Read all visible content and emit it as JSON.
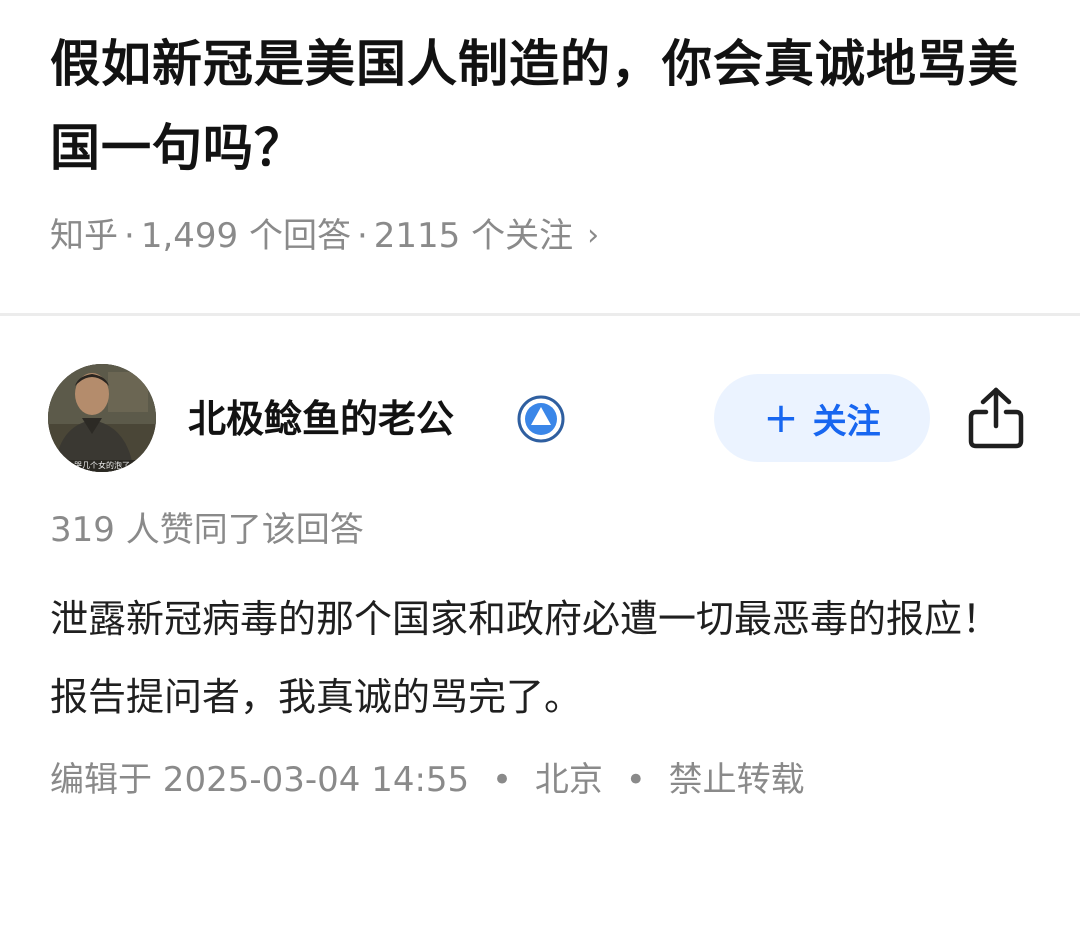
{
  "question": {
    "title": "假如新冠是美国人制造的，你会真诚地骂美国一句吗？",
    "source": "知乎",
    "answer_count": "1,499 个回答",
    "follower_count": "2115 个关注",
    "separator": "·",
    "chevron": "›"
  },
  "author": {
    "name": "北极鲶鱼的老公",
    "avatar_caption": "哭几个女的泡了",
    "badge_icon": "verified-badge-icon"
  },
  "actions": {
    "follow_plus": "+",
    "follow_label": "关注",
    "share_icon": "share-icon"
  },
  "answer": {
    "votes": "319 人赞同了该回答",
    "paragraphs": [
      "泄露新冠病毒的那个国家和政府必遭一切最恶毒的报应！",
      "报告提问者，我真诚的骂完了。"
    ],
    "edited_label": "编辑于 2025-03-04 14:55",
    "location": "北京",
    "copyright": "禁止转载",
    "dot": "•"
  },
  "colors": {
    "accent": "#1766f0",
    "follow_bg": "#ebf3ff",
    "meta_text": "#8a8a8a",
    "divider": "#ececec"
  }
}
